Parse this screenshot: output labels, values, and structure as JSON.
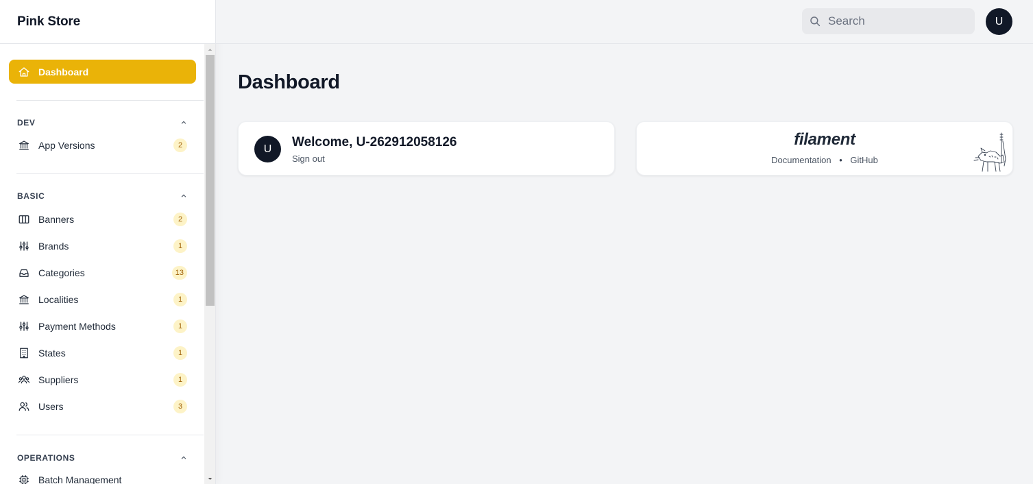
{
  "app": {
    "brand": "Pink Store"
  },
  "header": {
    "search_placeholder": "Search",
    "user_initial": "U"
  },
  "sidebar": {
    "dashboard": {
      "label": "Dashboard",
      "icon": "home-icon"
    },
    "groups": [
      {
        "label": "DEV",
        "items": [
          {
            "label": "App Versions",
            "badge": "2",
            "icon": "building-library-icon"
          }
        ]
      },
      {
        "label": "BASIC",
        "items": [
          {
            "label": "Banners",
            "badge": "2",
            "icon": "view-columns-icon"
          },
          {
            "label": "Brands",
            "badge": "1",
            "icon": "adjustments-icon"
          },
          {
            "label": "Categories",
            "badge": "13",
            "icon": "inbox-stack-icon"
          },
          {
            "label": "Localities",
            "badge": "1",
            "icon": "building-library-icon"
          },
          {
            "label": "Payment Methods",
            "badge": "1",
            "icon": "adjustments-icon"
          },
          {
            "label": "States",
            "badge": "1",
            "icon": "building-office-icon"
          },
          {
            "label": "Suppliers",
            "badge": "1",
            "icon": "user-group-icon"
          },
          {
            "label": "Users",
            "badge": "3",
            "icon": "users-icon"
          }
        ]
      },
      {
        "label": "OPERATIONS",
        "items": [
          {
            "label": "Batch Management",
            "icon": "cpu-chip-icon"
          }
        ]
      }
    ]
  },
  "main": {
    "title": "Dashboard",
    "welcome": {
      "avatar_initial": "U",
      "title": "Welcome, U-262912058126",
      "signout": "Sign out"
    },
    "filament": {
      "logo": "filament",
      "docs": "Documentation",
      "separator": "•",
      "github": "GitHub"
    }
  },
  "colors": {
    "accent": "#eab308",
    "badge_bg": "#fdf3c7",
    "badge_text": "#a16207",
    "avatar_bg": "#111827",
    "page_bg": "#f3f4f6"
  }
}
